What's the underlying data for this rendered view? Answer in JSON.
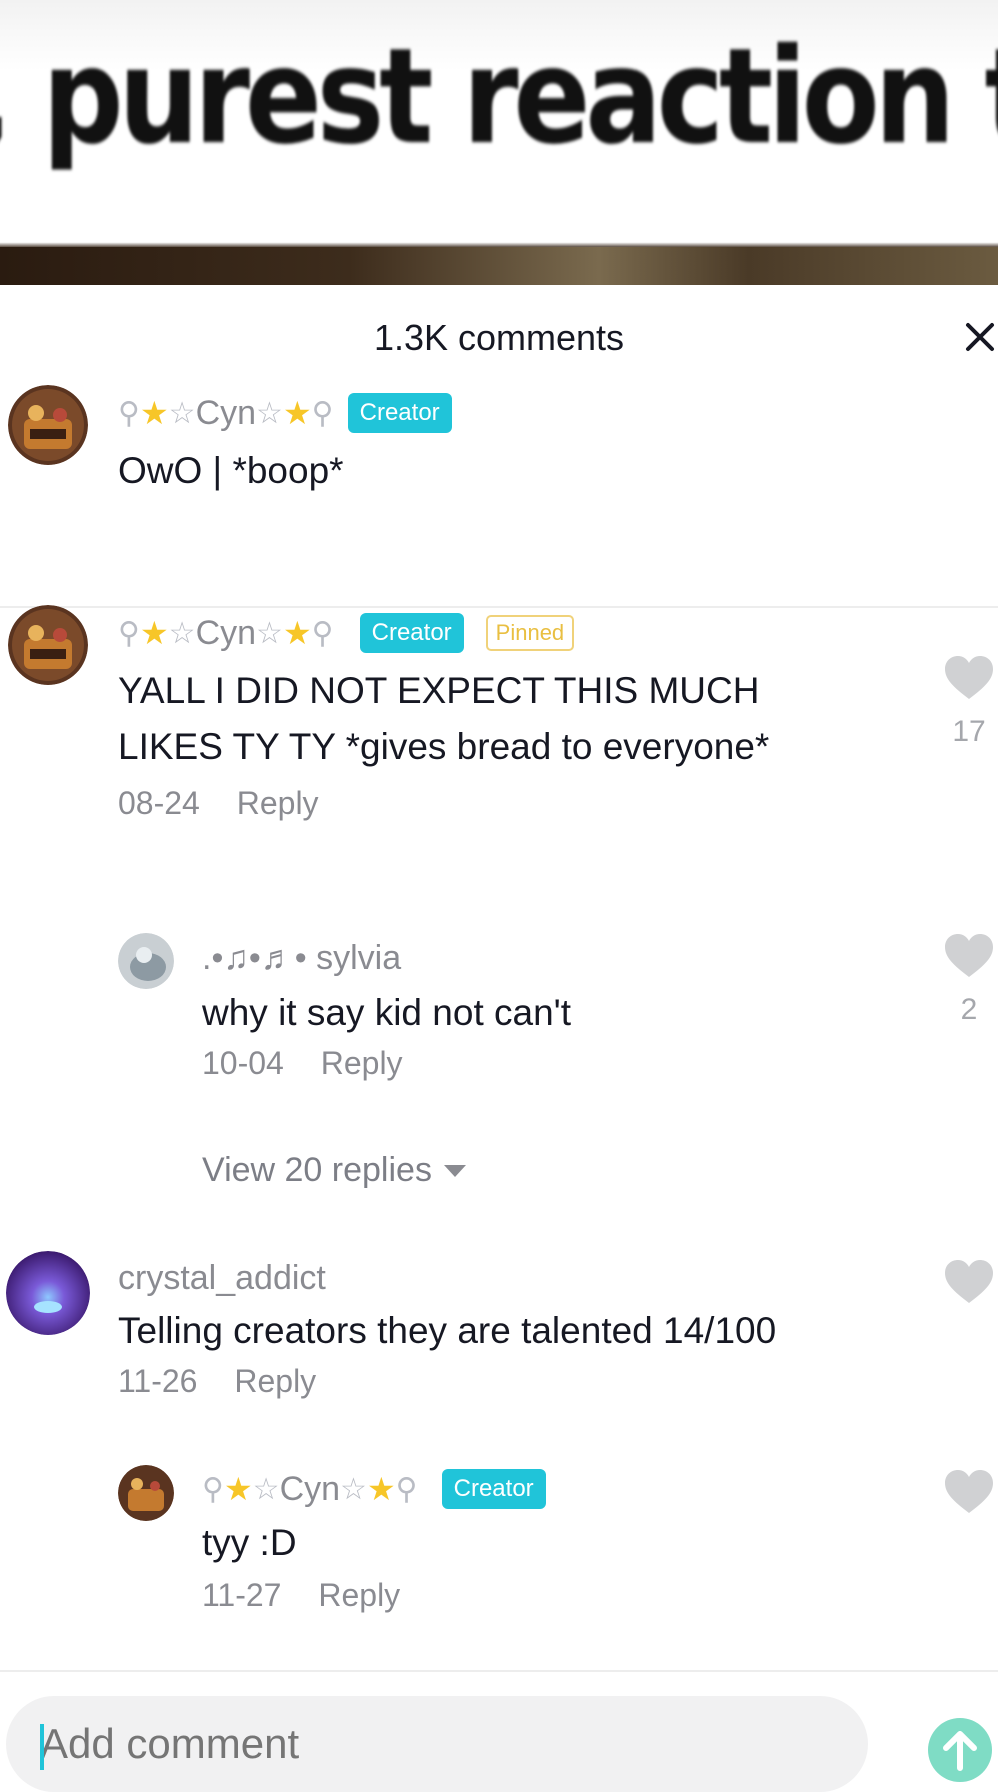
{
  "video": {
    "caption": ", purest reaction t"
  },
  "sheet": {
    "title": "1.3K comments"
  },
  "comments": [
    {
      "username": "Cyn",
      "badge": "Creator",
      "text": "OwO | *boop*"
    },
    {
      "username": "Cyn",
      "badge": "Creator",
      "pinned": "Pinned",
      "text_line1": "YALL I DID NOT EXPECT THIS MUCH",
      "text_line2": "LIKES TY TY *gives bread to everyone*",
      "date": "08-24",
      "reply": "Reply",
      "likes": "17"
    },
    {
      "username": ".•♫•♬• sylvia",
      "text": "why it say kid not can't",
      "date": "10-04",
      "reply": "Reply",
      "likes": "2"
    },
    {
      "view_replies": "View 20 replies"
    },
    {
      "username": "crystal_addict",
      "text": "Telling creators they are talented 14/100",
      "date": "11-26",
      "reply": "Reply"
    },
    {
      "username": "Cyn",
      "badge": "Creator",
      "text": "tyy :D",
      "date": "11-27",
      "reply": "Reply"
    }
  ],
  "composer": {
    "placeholder": "Add comment"
  },
  "icons": {
    "close": "close-icon",
    "heart": "heart-icon",
    "send": "send-arrow-icon",
    "chevron": "triangle-down-icon"
  },
  "colors": {
    "accent": "#20c4d9",
    "pinned": "#e9bf41",
    "send": "#7fdcc5"
  }
}
